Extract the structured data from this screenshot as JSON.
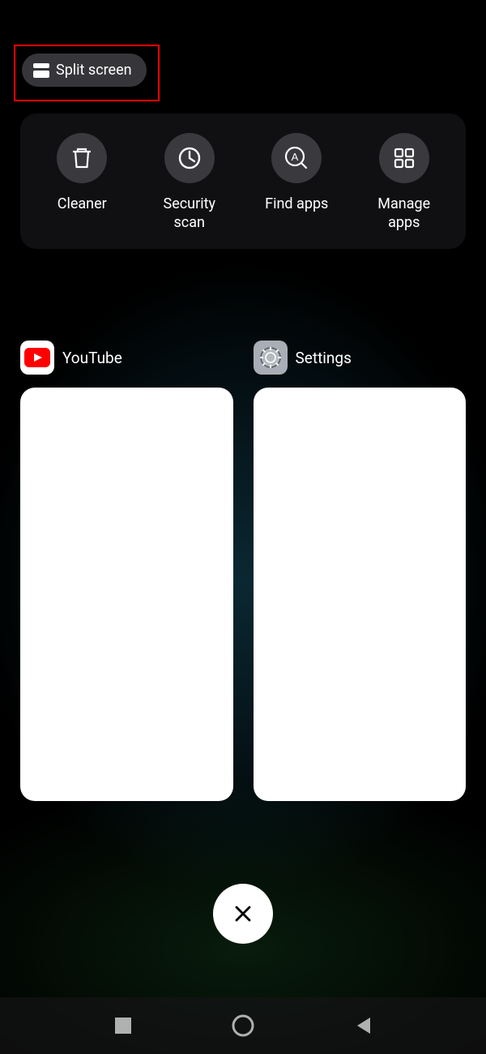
{
  "split_screen": {
    "label": "Split screen"
  },
  "tools": {
    "cleaner": "Cleaner",
    "security_scan": "Security\nscan",
    "find_apps": "Find apps",
    "manage_apps": "Manage\napps"
  },
  "apps": {
    "youtube": "YouTube",
    "settings": "Settings"
  }
}
